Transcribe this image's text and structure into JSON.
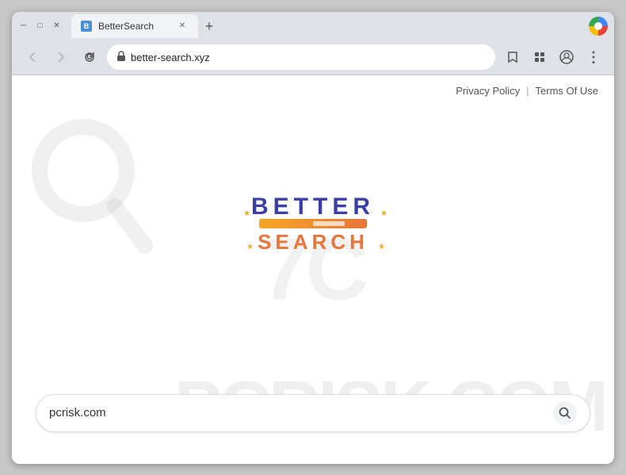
{
  "browser": {
    "tab_title": "BetterSearch",
    "tab_favicon": "B",
    "new_tab_btn": "+",
    "url": "better-search.xyz",
    "nav": {
      "back": "←",
      "forward": "→",
      "reload": "↻"
    }
  },
  "page": {
    "top_links": {
      "privacy_policy": "Privacy Policy",
      "separator": "|",
      "terms_of_use": "Terms Of Use"
    },
    "logo": {
      "better": "BETTER",
      "search": "SEARCH"
    },
    "search": {
      "placeholder": "pcrisk.com",
      "value": "pcrisk.com"
    },
    "watermark": "PCRISK.COM"
  },
  "icons": {
    "lock": "🔒",
    "star": "☆",
    "puzzle": "🧩",
    "profile": "👤",
    "menu": "⋮",
    "search": "🔍"
  }
}
